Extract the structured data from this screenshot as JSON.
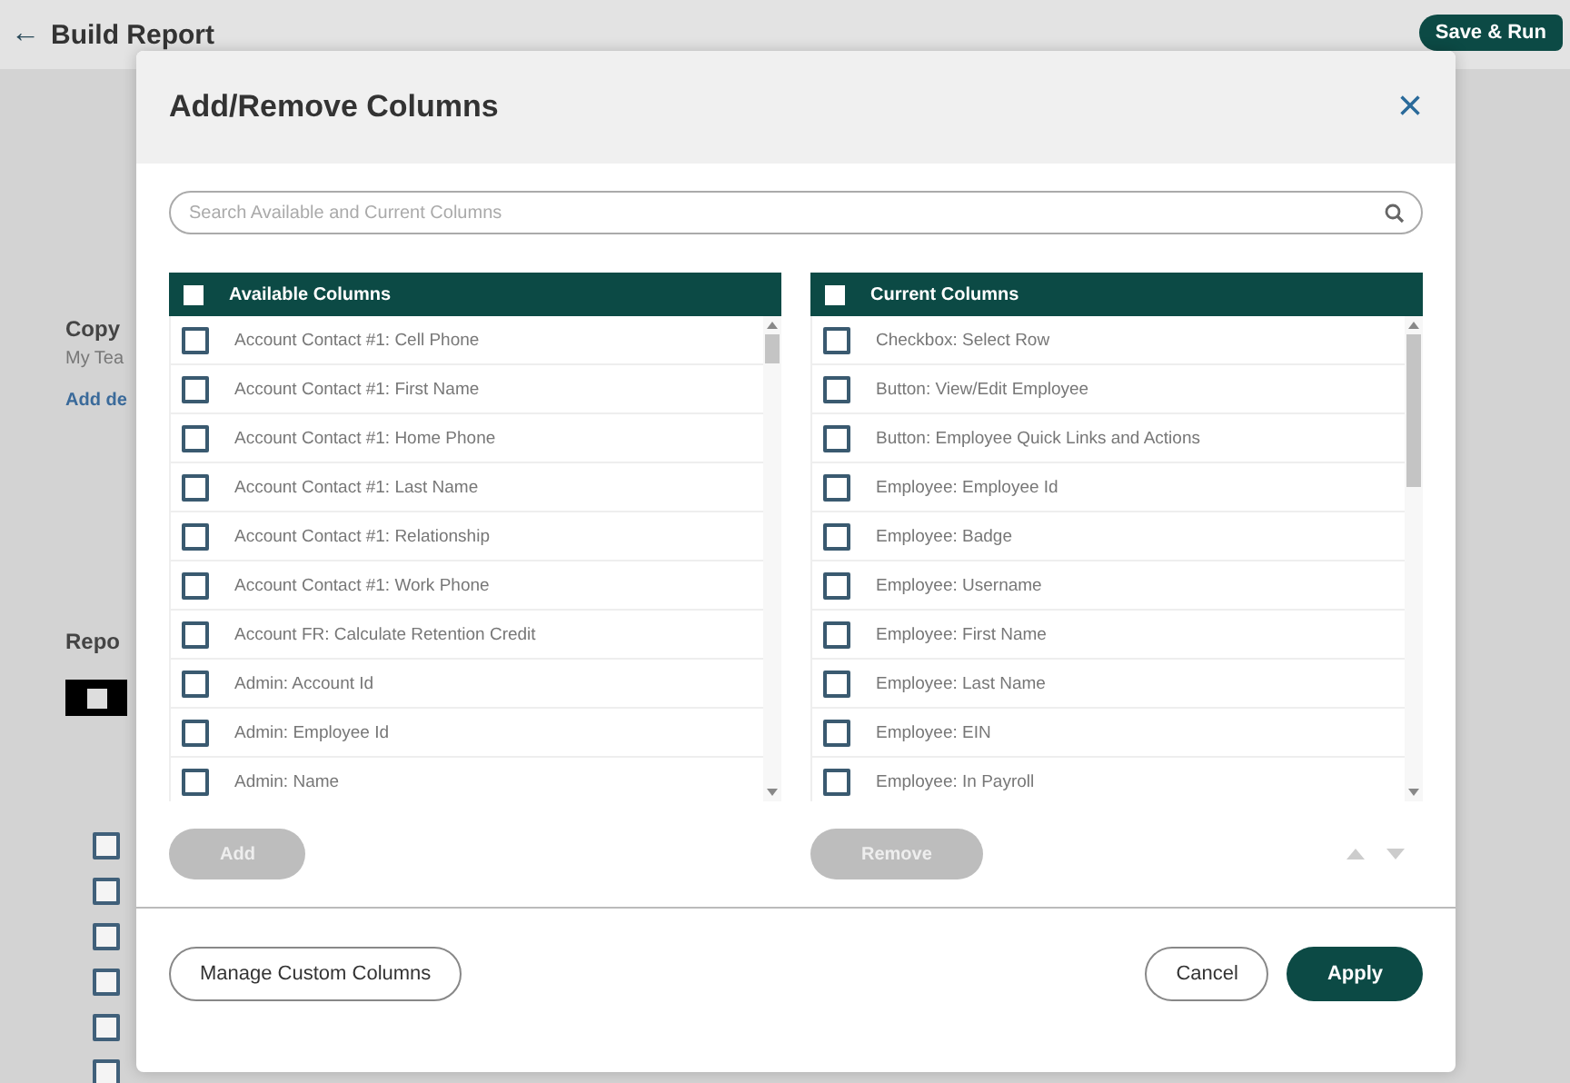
{
  "page": {
    "back_icon": "←",
    "title": "Build Report",
    "save_button": "Save & Run",
    "behind": [
      {
        "kind": "heading",
        "text": "Copy"
      },
      {
        "kind": "text",
        "text": "My Tea"
      },
      {
        "kind": "link",
        "text": "Add de"
      },
      {
        "kind": "heading",
        "text": "Repo"
      }
    ],
    "row_checks": [
      {
        "checked": false
      },
      {
        "checked": false
      },
      {
        "checked": false
      },
      {
        "checked": false
      },
      {
        "checked": false
      },
      {
        "checked": false
      }
    ]
  },
  "dialog": {
    "title": "Add/Remove Columns",
    "close": "×",
    "search": {
      "placeholder": "Search Available and Current Columns"
    },
    "lists": [
      {
        "title": "Available Columns",
        "checked": false,
        "button": {
          "label": "Add",
          "disabled": true
        },
        "rows": [
          {
            "label": "Account Contact #1: Cell Phone",
            "checked": false
          },
          {
            "label": "Account Contact #1: First Name",
            "checked": false
          },
          {
            "label": "Account Contact #1: Home Phone",
            "checked": false
          },
          {
            "label": "Account Contact #1: Last Name",
            "checked": false
          },
          {
            "label": "Account Contact #1: Relationship",
            "checked": false
          },
          {
            "label": "Account Contact #1: Work Phone",
            "checked": false
          },
          {
            "label": "Account FR: Calculate Retention Credit",
            "checked": false
          },
          {
            "label": "Admin: Account Id",
            "checked": false
          },
          {
            "label": "Admin: Employee Id",
            "checked": false
          },
          {
            "label": "Admin: Name",
            "checked": false
          }
        ]
      },
      {
        "title": "Current Columns",
        "checked": false,
        "button": {
          "label": "Remove",
          "disabled": true
        },
        "rows": [
          {
            "label": "Checkbox: Select Row",
            "checked": false
          },
          {
            "label": "Button: View/Edit Employee",
            "checked": false
          },
          {
            "label": "Button: Employee Quick Links and Actions",
            "checked": false
          },
          {
            "label": "Employee: Employee Id",
            "checked": false
          },
          {
            "label": "Employee: Badge",
            "checked": false
          },
          {
            "label": "Employee: Username",
            "checked": false
          },
          {
            "label": "Employee: First Name",
            "checked": false
          },
          {
            "label": "Employee: Last Name",
            "checked": false
          },
          {
            "label": "Employee: EIN",
            "checked": false
          },
          {
            "label": "Employee: In Payroll",
            "checked": false
          }
        ]
      }
    ],
    "move_disabled": true,
    "footer": {
      "manage": "Manage Custom Columns",
      "cancel": "Cancel",
      "apply": "Apply"
    }
  }
}
